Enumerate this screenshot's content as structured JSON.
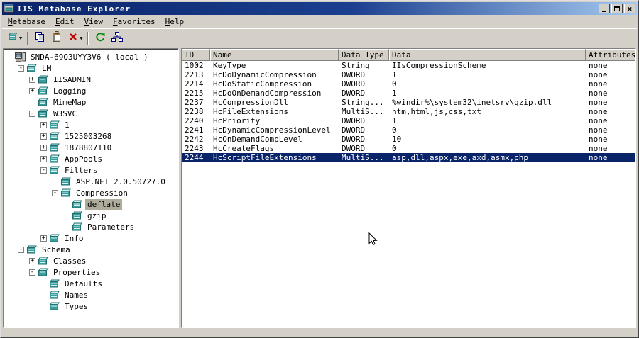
{
  "window": {
    "title": "IIS Metabase Explorer"
  },
  "titlebar": {
    "buttons": [
      {
        "name": "minimize"
      },
      {
        "name": "maximize"
      },
      {
        "name": "close"
      }
    ]
  },
  "menu": {
    "items": [
      {
        "label": "Metabase"
      },
      {
        "label": "Edit"
      },
      {
        "label": "View"
      },
      {
        "label": "Favorites"
      },
      {
        "label": "Help"
      }
    ]
  },
  "toolbar": {
    "items": [
      {
        "type": "button",
        "name": "new-key-button",
        "icon": "new-key-icon",
        "caret": true
      },
      {
        "type": "separator"
      },
      {
        "type": "button",
        "name": "copy-button",
        "icon": "copy-icon",
        "caret": false
      },
      {
        "type": "button",
        "name": "paste-button",
        "icon": "paste-icon",
        "caret": false
      },
      {
        "type": "button",
        "name": "delete-button",
        "icon": "delete-icon",
        "caret": true
      },
      {
        "type": "separator"
      },
      {
        "type": "button",
        "name": "refresh-button",
        "icon": "refresh-icon",
        "caret": false
      },
      {
        "type": "button",
        "name": "connect-button",
        "icon": "connect-icon",
        "caret": false
      }
    ]
  },
  "tree": {
    "items": [
      {
        "label": "SNDA-69Q3UYY3V6 ( local )",
        "level": 0,
        "toggle": "",
        "icon": "computer-icon",
        "selected": false
      },
      {
        "label": "LM",
        "level": 1,
        "toggle": "-",
        "icon": "node-icon",
        "selected": false
      },
      {
        "label": "IISADMIN",
        "level": 2,
        "toggle": "+",
        "icon": "node-icon",
        "selected": false
      },
      {
        "label": "Logging",
        "level": 2,
        "toggle": "+",
        "icon": "node-icon",
        "selected": false
      },
      {
        "label": "MimeMap",
        "level": 2,
        "toggle": "",
        "icon": "node-icon",
        "selected": false
      },
      {
        "label": "W3SVC",
        "level": 2,
        "toggle": "-",
        "icon": "node-icon",
        "selected": false
      },
      {
        "label": "1",
        "level": 3,
        "toggle": "+",
        "icon": "node-icon",
        "selected": false
      },
      {
        "label": "1525003268",
        "level": 3,
        "toggle": "+",
        "icon": "node-icon",
        "selected": false
      },
      {
        "label": "1878807110",
        "level": 3,
        "toggle": "+",
        "icon": "node-icon",
        "selected": false
      },
      {
        "label": "AppPools",
        "level": 3,
        "toggle": "+",
        "icon": "node-icon",
        "selected": false
      },
      {
        "label": "Filters",
        "level": 3,
        "toggle": "-",
        "icon": "node-icon",
        "selected": false
      },
      {
        "label": "ASP.NET_2.0.50727.0",
        "level": 4,
        "toggle": "",
        "icon": "node-icon",
        "selected": false
      },
      {
        "label": "Compression",
        "level": 4,
        "toggle": "-",
        "icon": "node-icon",
        "selected": false
      },
      {
        "label": "deflate",
        "level": 5,
        "toggle": "",
        "icon": "node-icon",
        "selected": true
      },
      {
        "label": "gzip",
        "level": 5,
        "toggle": "",
        "icon": "node-icon",
        "selected": false
      },
      {
        "label": "Parameters",
        "level": 5,
        "toggle": "",
        "icon": "node-icon",
        "selected": false
      },
      {
        "label": "Info",
        "level": 3,
        "toggle": "+",
        "icon": "node-icon",
        "selected": false
      },
      {
        "label": "Schema",
        "level": 1,
        "toggle": "-",
        "icon": "node-icon",
        "selected": false
      },
      {
        "label": "Classes",
        "level": 2,
        "toggle": "+",
        "icon": "node-icon",
        "selected": false
      },
      {
        "label": "Properties",
        "level": 2,
        "toggle": "-",
        "icon": "node-icon",
        "selected": false
      },
      {
        "label": "Defaults",
        "level": 3,
        "toggle": "",
        "icon": "node-icon",
        "selected": false
      },
      {
        "label": "Names",
        "level": 3,
        "toggle": "",
        "icon": "node-icon",
        "selected": false
      },
      {
        "label": "Types",
        "level": 3,
        "toggle": "",
        "icon": "node-icon",
        "selected": false
      }
    ]
  },
  "list": {
    "columns": [
      {
        "label": "ID"
      },
      {
        "label": "Name"
      },
      {
        "label": "Data Type"
      },
      {
        "label": "Data"
      },
      {
        "label": "Attributes"
      }
    ],
    "rows": [
      {
        "id": "1002",
        "name": "KeyType",
        "data_type": "String",
        "data": "IIsCompressionScheme",
        "attributes": "none",
        "selected": false
      },
      {
        "id": "2213",
        "name": "HcDoDynamicCompression",
        "data_type": "DWORD",
        "data": "1",
        "attributes": "none",
        "selected": false
      },
      {
        "id": "2214",
        "name": "HcDoStaticCompression",
        "data_type": "DWORD",
        "data": "0",
        "attributes": "none",
        "selected": false
      },
      {
        "id": "2215",
        "name": "HcDoOnDemandCompression",
        "data_type": "DWORD",
        "data": "1",
        "attributes": "none",
        "selected": false
      },
      {
        "id": "2237",
        "name": "HcCompressionDll",
        "data_type": "String...",
        "data": "%windir%\\system32\\inetsrv\\gzip.dll",
        "attributes": "none",
        "selected": false
      },
      {
        "id": "2238",
        "name": "HcFileExtensions",
        "data_type": "MultiS...",
        "data": "htm,html,js,css,txt",
        "attributes": "none",
        "selected": false
      },
      {
        "id": "2240",
        "name": "HcPriority",
        "data_type": "DWORD",
        "data": "1",
        "attributes": "none",
        "selected": false
      },
      {
        "id": "2241",
        "name": "HcDynamicCompressionLevel",
        "data_type": "DWORD",
        "data": "0",
        "attributes": "none",
        "selected": false
      },
      {
        "id": "2242",
        "name": "HcOnDemandCompLevel",
        "data_type": "DWORD",
        "data": "10",
        "attributes": "none",
        "selected": false
      },
      {
        "id": "2243",
        "name": "HcCreateFlags",
        "data_type": "DWORD",
        "data": "0",
        "attributes": "none",
        "selected": false
      },
      {
        "id": "2244",
        "name": "HcScriptFileExtensions",
        "data_type": "MultiS...",
        "data": "asp,dll,aspx,exe,axd,asmx,php",
        "attributes": "none",
        "selected": true
      }
    ]
  },
  "colors": {
    "titlebar_gradient_start": "#0a246a",
    "titlebar_gradient_end": "#a6caf0",
    "selected_row_bg": "#0a246a",
    "selected_row_text": "#ffffff",
    "tree_inactive_selection_bg": "#b0ac9c",
    "panel_bg": "#d4d0c8",
    "node_icon_teal": "#3a9d9d"
  }
}
